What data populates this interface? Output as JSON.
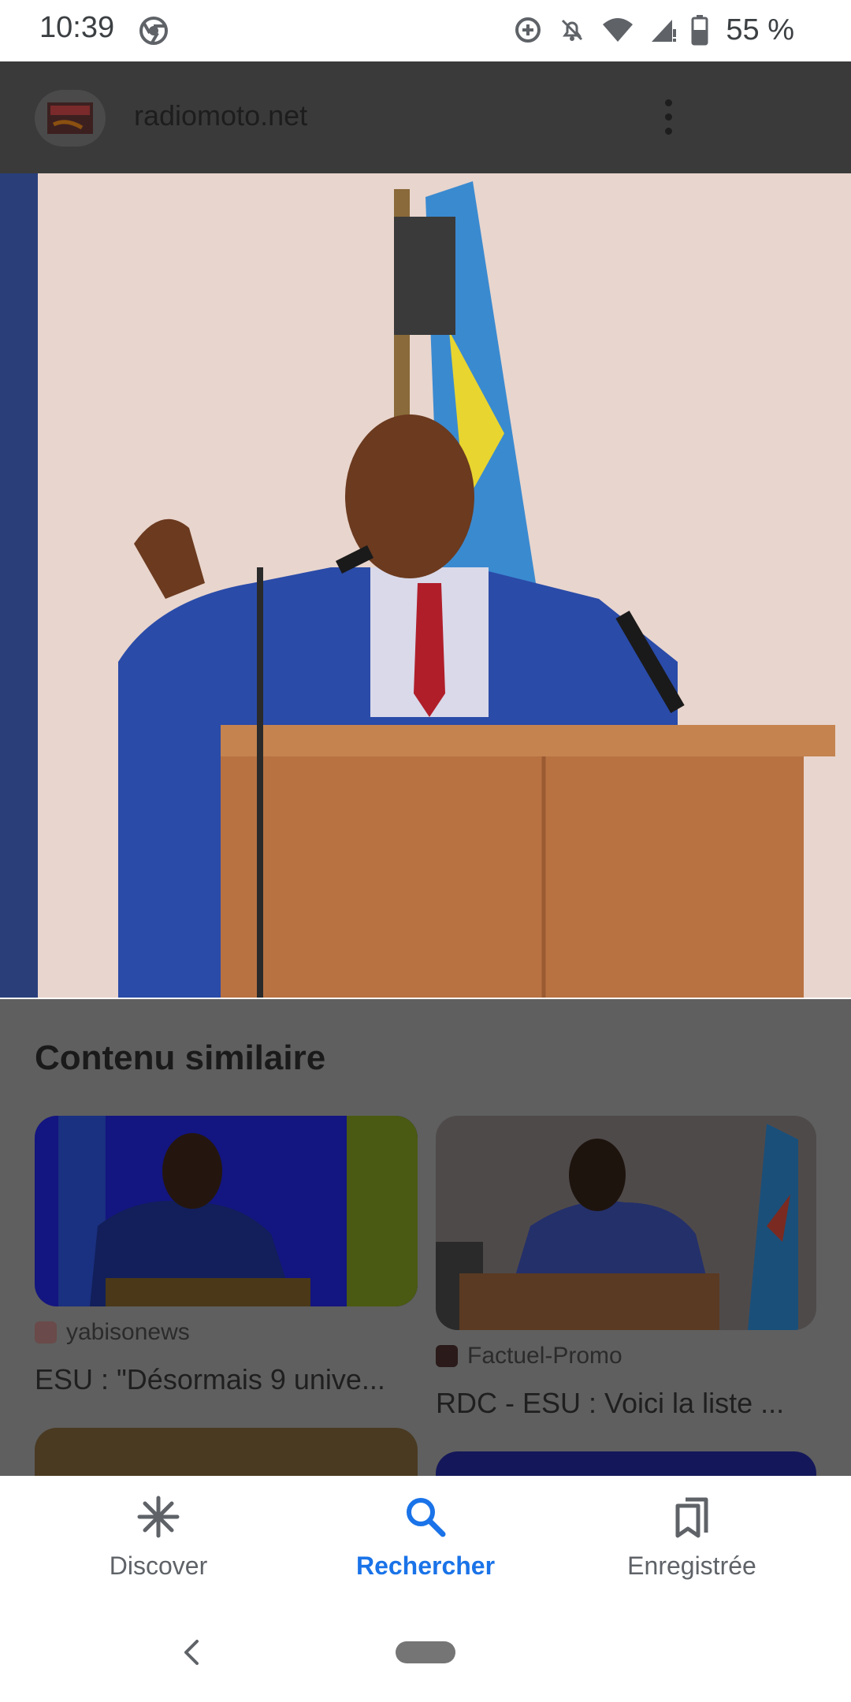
{
  "status_bar": {
    "time": "10:39",
    "battery": "55 %",
    "icons": [
      "chrome-icon",
      "data-saver-icon",
      "bell-off-icon",
      "wifi-icon",
      "signal-icon",
      "battery-icon"
    ]
  },
  "viewer": {
    "site_name": "radiomoto.net",
    "menu_icon": "more-vert-icon"
  },
  "similar": {
    "title": "Contenu similaire",
    "cards": [
      {
        "source": "yabisonews",
        "title": "ESU : \"Désormais 9 unive..."
      },
      {
        "source": "Factuel-Promo",
        "title": "RDC - ESU : Voici la liste ..."
      }
    ]
  },
  "bottom_nav": {
    "items": [
      {
        "label": "Discover",
        "icon": "discover-asterisk-icon"
      },
      {
        "label": "Rechercher",
        "icon": "search-icon"
      },
      {
        "label": "Enregistrée",
        "icon": "bookmarks-icon"
      }
    ],
    "active": "Rechercher"
  },
  "colors": {
    "accent": "#1a73e8",
    "overlay": "#5f5f5f",
    "header_dim": "#3a3a3a"
  }
}
